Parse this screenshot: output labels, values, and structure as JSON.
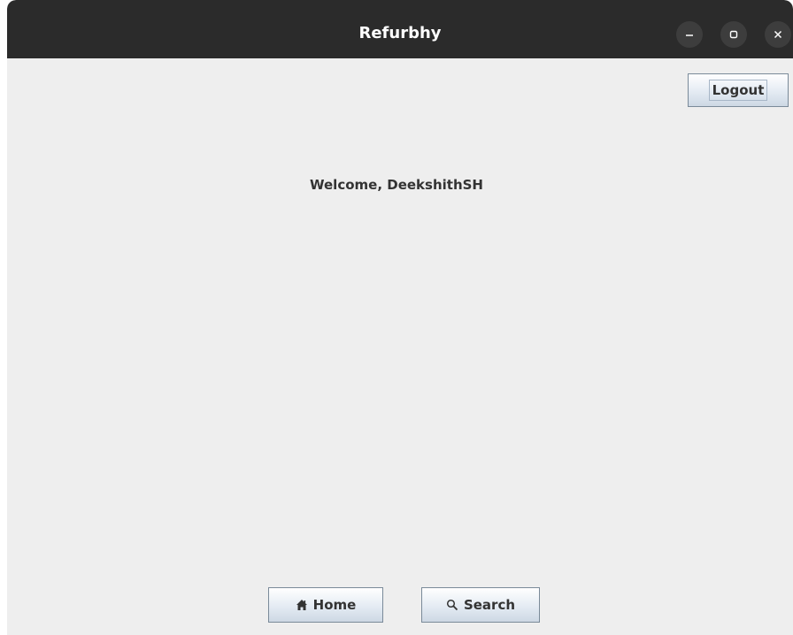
{
  "window": {
    "title": "Refurbhy",
    "controls": [
      "minimize",
      "maximize",
      "close"
    ]
  },
  "header": {
    "logout_label": "Logout"
  },
  "main": {
    "welcome_text": "Welcome, DeekshithSH"
  },
  "footer": {
    "home_label": "Home",
    "home_icon": "home-icon",
    "search_label": "Search",
    "search_icon": "search-icon"
  },
  "colors": {
    "titlebar": "#2b2b2b",
    "background": "#eeeeee",
    "text": "#333333"
  }
}
